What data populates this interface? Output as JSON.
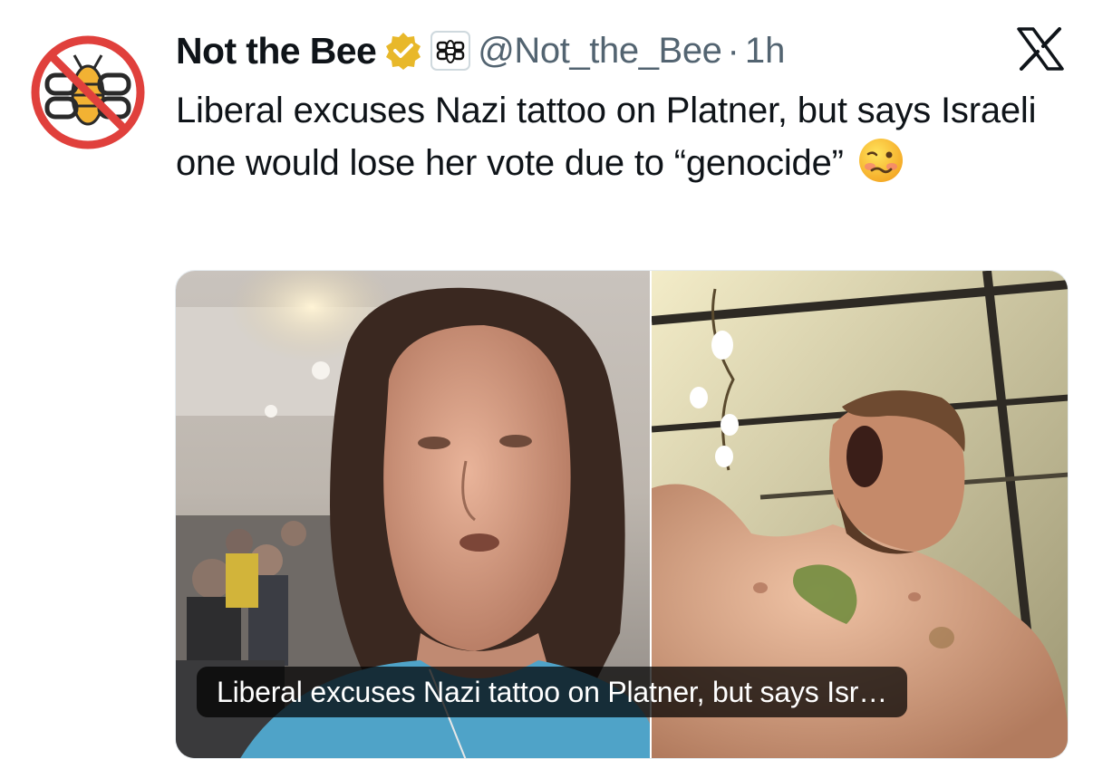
{
  "account": {
    "display_name": "Not the Bee",
    "handle": "@Not_the_Bee",
    "separator": "·",
    "time": "1h",
    "avatar_icon": "bee-logo-crossed-icon",
    "verified_icon": "gold-verified-badge-icon",
    "affiliation_icon": "bee-affiliate-badge-icon"
  },
  "tweet": {
    "text": "Liberal excuses Nazi tattoo on Platner, but says Israeli one would lose her vote due to “genocide”",
    "emoji": "woozy-face-emoji"
  },
  "media": {
    "caption": "Liberal excuses Nazi tattoo on Platner, but says Isr…",
    "left_image": "woman-speaking-photo",
    "right_image": "shirtless-man-with-tattoo-photo"
  },
  "colors": {
    "text": "#0f1419",
    "secondary": "#536471",
    "verified_gold": "#e8b82a",
    "avatar_red": "#e0403c",
    "bee_yellow": "#f2b233"
  },
  "logo": {
    "icon": "x-logo-icon"
  }
}
